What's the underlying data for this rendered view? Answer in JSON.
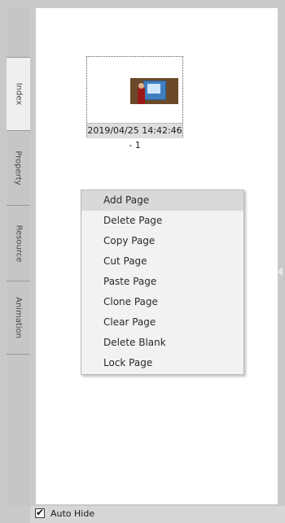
{
  "side_tabs": [
    {
      "label": "Index",
      "active": true
    },
    {
      "label": "Property",
      "active": false
    },
    {
      "label": "Resource",
      "active": false
    },
    {
      "label": "Animation",
      "active": false
    }
  ],
  "thumbnail": {
    "caption": "2019/04/25 14:42:46 - 1"
  },
  "context_menu": {
    "items": [
      {
        "label": "Add Page",
        "highlighted": true
      },
      {
        "label": "Delete Page",
        "highlighted": false
      },
      {
        "label": "Copy Page",
        "highlighted": false
      },
      {
        "label": "Cut Page",
        "highlighted": false
      },
      {
        "label": "Paste Page",
        "highlighted": false
      },
      {
        "label": "Clone Page",
        "highlighted": false
      },
      {
        "label": "Clear Page",
        "highlighted": false
      },
      {
        "label": "Delete Blank",
        "highlighted": false
      },
      {
        "label": "Lock Page",
        "highlighted": false
      }
    ]
  },
  "footer": {
    "auto_hide_label": "Auto Hide",
    "auto_hide_checked": true,
    "check_glyph": "✔"
  }
}
